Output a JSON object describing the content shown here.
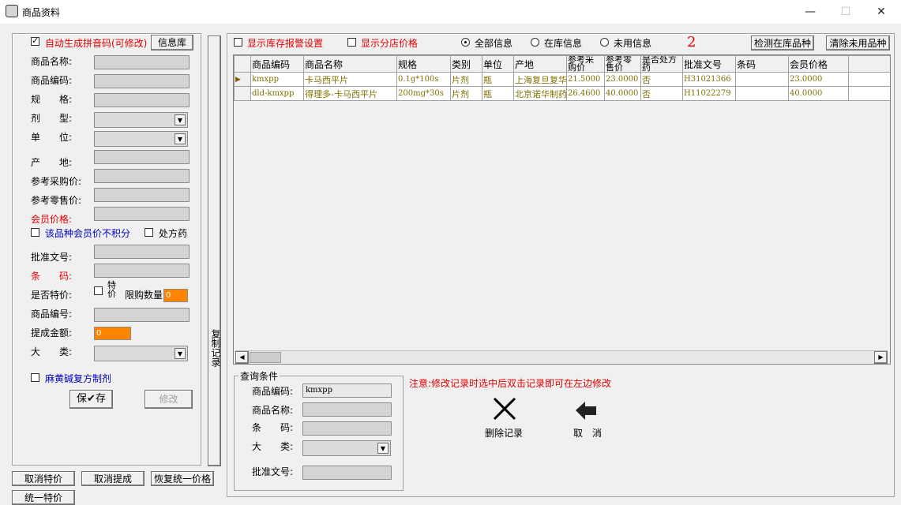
{
  "window": {
    "title": "商品资料",
    "minimize": "—",
    "maximize": "☐",
    "close": "✕"
  },
  "left_panel": {
    "auto_pinyin_label": "自动生成拼音码(可修改)",
    "info_lib_button": "信息库",
    "fields": {
      "product_name": "商品名称:",
      "product_code": "商品编码:",
      "spec": "规　　格:",
      "dosage_form": "剂　　型:",
      "unit": "单　　位:",
      "origin": "产　　地:",
      "ref_purchase_price": "参考采购价:",
      "ref_retail_price": "参考零售价:",
      "member_price": "会员价格:",
      "no_points_label": "该品种会员价不积分",
      "prescription_label": "处方药",
      "approval_no": "批准文号:",
      "barcode": "条　　码:",
      "is_special": "是否特价:",
      "special_label": "特价",
      "limit_qty": "限购数量",
      "limit_qty_value": "0",
      "product_no": "商品编号:",
      "commission": "提成金额:",
      "commission_value": "0",
      "category": "大　　类:",
      "ephedrine_label": "麻黄碱复方制剂"
    },
    "save_button": "保✔存",
    "modify_button": "修改"
  },
  "bottom_buttons": {
    "cancel_special": "取消特价",
    "cancel_commission": "取消提成",
    "restore_price": "恢复统一价格",
    "unify_special": "统一特价"
  },
  "copy_record": "复制记录",
  "toolbar": {
    "show_stock_alarm": "显示库存报警设置",
    "show_branch_price": "显示分店价格",
    "radio_all": "全部信息",
    "radio_in_stock": "在库信息",
    "radio_unused": "未用信息",
    "marker": "2",
    "check_stock_button": "检测在库品种",
    "clear_unused_button": "清除未用品种"
  },
  "grid": {
    "columns": [
      "商品编码",
      "商品名称",
      "规格",
      "类别",
      "单位",
      "产地",
      "参考采购价",
      "参考零售价",
      "是否处方药",
      "批准文号",
      "条码",
      "会员价格"
    ],
    "header_labels": [
      "商品编码",
      "商品名称",
      "规格",
      "类别",
      "单位",
      "产地",
      "参考采\n购价",
      "参考零\n售价",
      "是否处方\n药",
      "批准文号",
      "条码",
      "会员价格"
    ],
    "rows": [
      [
        "kmxpp",
        "卡马西平片",
        "0.1g*100s",
        "片剂",
        "瓶",
        "上海复旦复华",
        "21.5000",
        "23.0000",
        "否",
        "H31021366",
        "",
        "23.0000"
      ],
      [
        "dld-kmxpp",
        "得理多-卡马西平片",
        "200mg*30s",
        "片剂",
        "瓶",
        "北京诺华制药",
        "26.4600",
        "40.0000",
        "否",
        "H11022279",
        "",
        "40.0000"
      ]
    ]
  },
  "query": {
    "group_title": "查询条件",
    "product_code_label": "商品编码:",
    "product_code_value": "kmxpp",
    "product_name_label": "商品名称:",
    "barcode_label": "条　　码:",
    "category_label": "大　　类:",
    "approval_label": "批准文号:"
  },
  "notice": "注意:修改记录时选中后双击记录即可在左边修改",
  "actions": {
    "delete": "删除记录",
    "cancel": "取　消"
  }
}
